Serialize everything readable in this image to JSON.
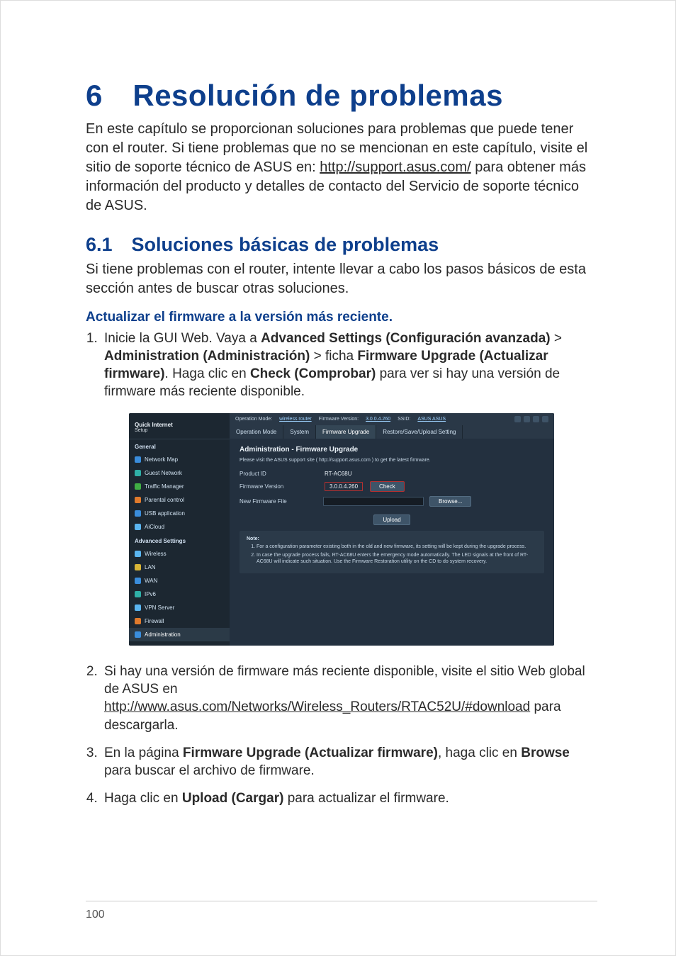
{
  "page_number": "100",
  "main_title": "6 Resolución de problemas",
  "intro_before_link": "En este capítulo se proporcionan soluciones para problemas que puede tener con el router. Si tiene problemas que no se mencionan en este capítulo, visite el sitio de soporte técnico de ASUS en: ",
  "intro_link": "http://support.asus.com/",
  "intro_after_link": " para obtener más información del producto y detalles de contacto del Servicio de soporte técnico de ASUS.",
  "sub_title": "6.1 Soluciones básicas de problemas",
  "sub_intro": "Si tiene problemas con el router, intente llevar a cabo los pasos básicos de esta sección antes de buscar otras soluciones.",
  "step_title": "Actualizar el firmware a la versión más reciente.",
  "steps": {
    "s1": {
      "t0": "Inicie la GUI Web. Vaya a ",
      "b0": "Advanced Settings (Configuración avanzada)",
      "t1": " > ",
      "b1": "Administration (Administración)",
      "t2": " > ficha ",
      "b2": "Firmware Upgrade (Actualizar firmware)",
      "t3": ". Haga clic en ",
      "b3": "Check (Comprobar)",
      "t4": " para ver si hay una versión de firmware más reciente disponible."
    },
    "s2": {
      "t0": "Si hay una versión de firmware más reciente disponible, visite el sitio Web global de ASUS en ",
      "l0": "http://www.asus.com/Networks/Wireless_Routers/RTAC52U/#download",
      "t1": " para descargarla."
    },
    "s3": {
      "t0": "En la página ",
      "b0": "Firmware Upgrade (Actualizar firmware)",
      "t1": ", haga clic en ",
      "b1": "Browse",
      "t2": " para buscar el archivo de firmware."
    },
    "s4": {
      "t0": "Haga clic en ",
      "b0": "Upload (Cargar)",
      "t1": " para actualizar el firmware."
    }
  },
  "ui": {
    "quick_internet": "Quick Internet",
    "quick_setup": "Setup",
    "general": "General",
    "nav": {
      "network_map": "Network Map",
      "guest_network": "Guest Network",
      "traffic_manager": "Traffic Manager",
      "parental_control": "Parental control",
      "usb_application": "USB application",
      "aicloud": "AiCloud"
    },
    "adv_head": "Advanced Settings",
    "adv": {
      "wireless": "Wireless",
      "lan": "LAN",
      "wan": "WAN",
      "ipv6": "IPv6",
      "vpn": "VPN Server",
      "firewall": "Firewall",
      "admin": "Administration"
    },
    "topbar": {
      "op_mode_lbl": "Operation Mode:",
      "op_mode_val": "wireless router",
      "fw_lbl": "Firmware Version:",
      "fw_val": "3.0.0.4.260",
      "ssid_lbl": "SSID:",
      "ssid_val": "ASUS ASUS"
    },
    "tabs": {
      "op_mode": "Operation Mode",
      "system": "System",
      "fw_upgrade": "Firmware Upgrade",
      "restore": "Restore/Save/Upload Setting"
    },
    "panel": {
      "title": "Administration - Firmware Upgrade",
      "note": "Please visit the ASUS support site ( http://support.asus.com ) to get the latest firmware.",
      "product_id_lbl": "Product ID",
      "product_id_val": "RT-AC68U",
      "fw_ver_lbl": "Firmware Version",
      "fw_ver_val": "3.0.0.4.260",
      "check_btn": "Check",
      "new_fw_lbl": "New Firmware File",
      "browse_btn": "Browse...",
      "upload_btn": "Upload",
      "notes_head": "Note:",
      "notes": {
        "n1": "For a configuration parameter existing both in the old and new firmware, its setting will be kept during the upgrade process.",
        "n2": "In case the upgrade process fails, RT-AC68U enters the emergency mode automatically. The LED signals at the front of RT-AC68U will indicate such situation. Use the Firmware Restoration utility on the CD to do system recovery."
      }
    }
  }
}
